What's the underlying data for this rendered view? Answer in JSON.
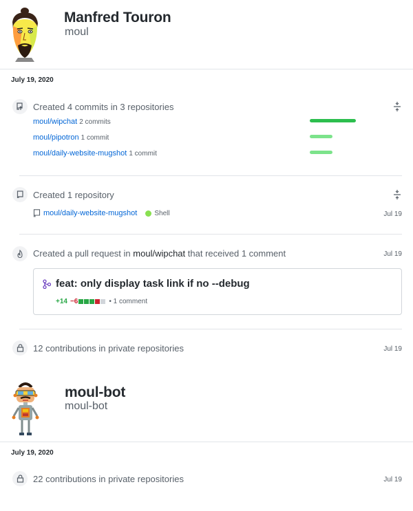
{
  "profiles": [
    {
      "name": "Manfred Touron",
      "login": "moul",
      "date": "July 19, 2020",
      "commits_event": {
        "title": "Created 4 commits in 3 repositories",
        "repos": [
          {
            "name": "moul/wipchat",
            "count": "2 commits"
          },
          {
            "name": "moul/pipotron",
            "count": "1 commit"
          },
          {
            "name": "moul/daily-website-mugshot",
            "count": "1 commit"
          }
        ]
      },
      "repo_event": {
        "title": "Created 1 repository",
        "repo": "moul/daily-website-mugshot",
        "language": "Shell",
        "language_color": "#89e051",
        "date": "Jul 19"
      },
      "pr_event": {
        "title_prefix": "Created a pull request in",
        "title_repo": "moul/wipchat",
        "title_suffix": "that received 1 comment",
        "date": "Jul 19",
        "pr_title": "feat: only display task link if no --debug",
        "additions": "+14",
        "deletions": "−6",
        "comments": "1 comment",
        "diff_boxes": [
          "added",
          "added",
          "added",
          "removed",
          "neutral"
        ]
      },
      "private_event": {
        "title": "12 contributions in private repositories",
        "date": "Jul 19"
      }
    },
    {
      "name": "moul-bot",
      "login": "moul-bot",
      "date": "July 19, 2020",
      "private_event": {
        "title": "22 contributions in private repositories",
        "date": "Jul 19"
      }
    }
  ],
  "colors": {
    "link": "#0366d6",
    "bar_full": "#2cbe4e",
    "bar_part": "#7ce38b",
    "added": "#28a745",
    "removed": "#cb2431"
  }
}
